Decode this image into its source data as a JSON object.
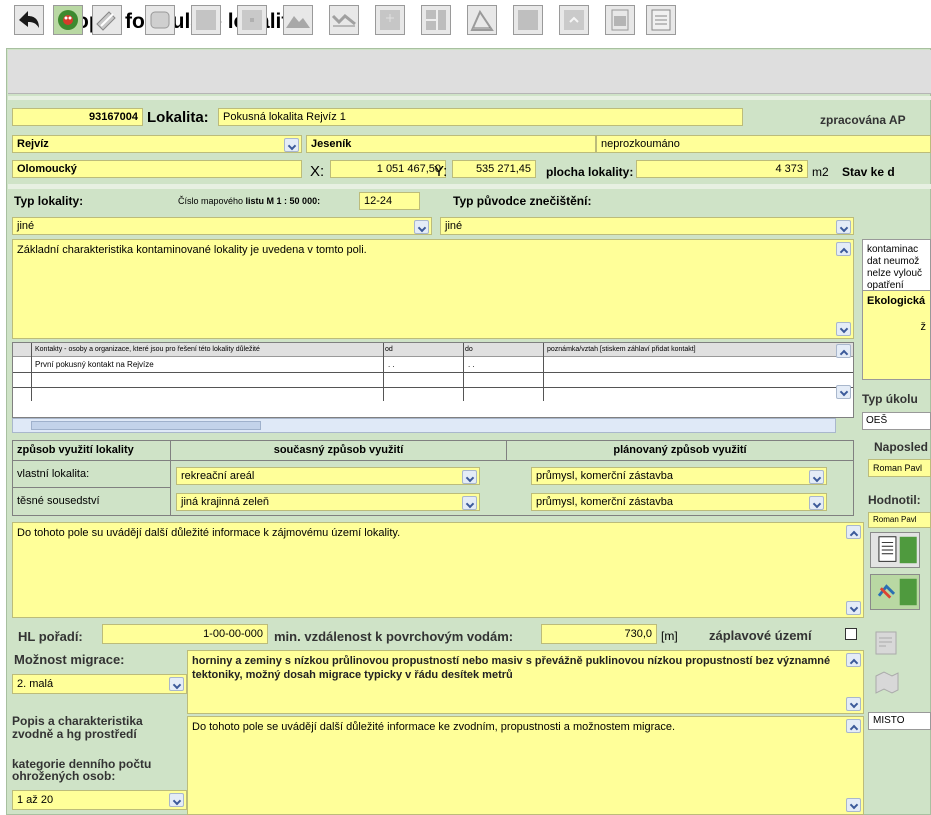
{
  "page_title": "Popis formuláře lokality",
  "header": {
    "id_number": "93167004",
    "lokalita_label": "Lokalita:",
    "lokalita_value": "Pokusná lokalita Rejvíz 1",
    "zpracovana_label": "zpracována AP",
    "obec": "Rejvíz",
    "okres": "Jeseník",
    "stav_pruzkumu": "neprozkoumáno",
    "kraj": "Olomoucký",
    "x_label": "X:",
    "x_value": "1 051 467,50",
    "y_label": "Y:",
    "y_value": "535 271,45",
    "plocha_label": "plocha lokality:",
    "plocha_value": "4 373",
    "plocha_unit": "m2",
    "stav_ke_label": "Stav ke d"
  },
  "typ": {
    "typ_lokality_label": "Typ lokality:",
    "mapovy_list_label_pre": "Číslo mapového ",
    "mapovy_list_label_bold": "listu M 1 : 50 000:",
    "mapovy_list_value": "12-24",
    "typ_puvodce_label": "Typ původce znečištění:",
    "typ_lokality_value": "jiné",
    "typ_puvodce_value": "jiné"
  },
  "characteristics_text": "Základní charakteristika kontaminované lokality je uvedena v tomto poli.",
  "contacts": {
    "headers": {
      "name": "Kontakty - osoby a organizace, které jsou pro řešení této lokality důležité",
      "od": "od",
      "do": "do",
      "note": "poznámka/vztah   [stiskem záhlaví přidat kontakt]"
    },
    "rows": [
      {
        "name": "První pokusný kontakt na Rejvíze",
        "od": ". .",
        "do": ". ."
      }
    ]
  },
  "usage": {
    "header_label": "způsob využití lokality",
    "current_header": "současný způsob využití",
    "planned_header": "plánovaný způsob využití",
    "rows": [
      {
        "label": "vlastní lokalita:",
        "current": "rekreační areál",
        "planned": "průmysl, komerční zástavba"
      },
      {
        "label": "těsné sousedství",
        "current": "jiná krajinná zeleň",
        "planned": "průmysl, komerční zástavba"
      }
    ]
  },
  "other_info_text": "Do tohoto pole su uvádějí další důležité informace k zájmovému území lokality.",
  "hl": {
    "poradi_label": "HL pořadí:",
    "poradi_value": "1-00-00-000",
    "vzdalenost_label": "min. vzdálenost k povrchovým vodám:",
    "vzdalenost_value": "730,0",
    "vzdalenost_unit": "[m]",
    "zaplavove_label": "záplavové území"
  },
  "migrace": {
    "label": "Možnost migrace:",
    "value": "2. malá",
    "text": "horniny a zeminy s nízkou průlinovou propustností nebo masiv s převážně puklinovou nízkou propustností bez významné tektoniky, možný dosah migrace typicky v řádu desítek metrů"
  },
  "zvodne": {
    "label": "Popis a charakteristika zvodně a hg prostředí",
    "text": "Do tohoto pole se uvádějí další důležité informace ke zvodním, propustnosti a možnostem migrace."
  },
  "kategorie": {
    "label": "kategorie denního počtu ohrožených osob:",
    "value": "1 až 20"
  },
  "right_panel": {
    "note_text": "kontaminac dat neumož nelze vylouč opatření",
    "ekologicka_label": "Ekologická",
    "ekologicka_sub": "ž",
    "typ_ukolu_label": "Typ úkolu",
    "typ_ukolu_value": "OEŠ",
    "naposled_label": "Naposled",
    "naposled_value": "Roman Pavl",
    "hodnotil_label": "Hodnotil:",
    "hodnotil_value": "Roman Pavl",
    "misto_value": "MISTO"
  },
  "colors": {
    "form_bg": "#cfe3c7",
    "field_yellow": "#ffff99",
    "toolbar_bg": "#dedede"
  }
}
